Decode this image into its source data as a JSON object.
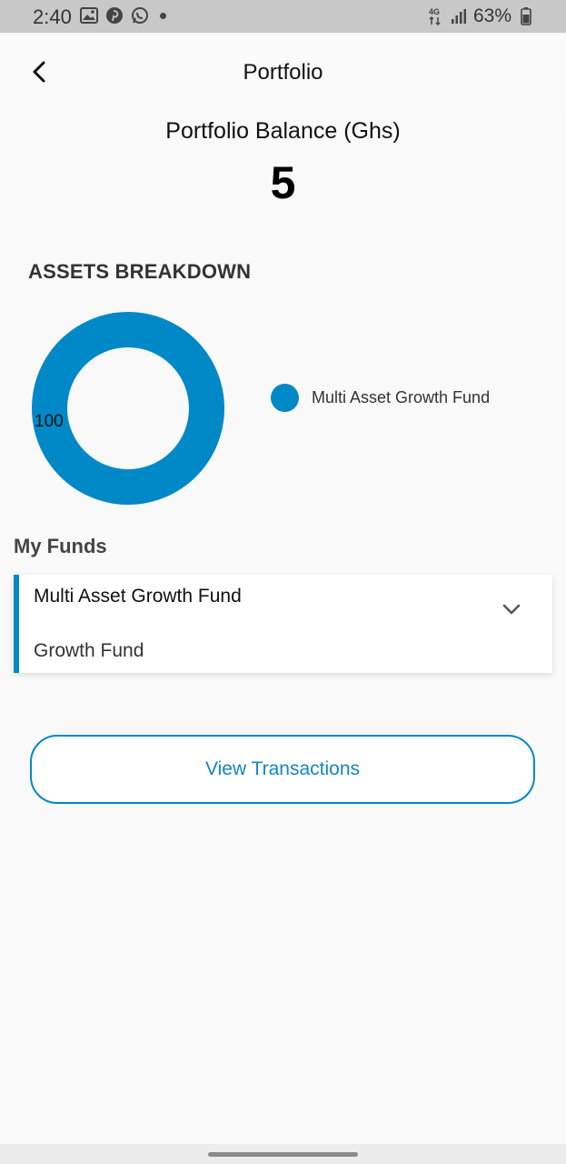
{
  "status_bar": {
    "time": "2:40",
    "battery_percent": "63%",
    "network_label": "4G",
    "icons": [
      "image-icon",
      "pinterest-icon",
      "whatsapp-icon",
      "notification-dot-icon",
      "network-4g-icon",
      "signal-icon",
      "battery-icon"
    ]
  },
  "header": {
    "title": "Portfolio",
    "back_icon": "chevron-left-icon"
  },
  "balance": {
    "label": "Portfolio Balance (Ghs)",
    "value": "5"
  },
  "assets": {
    "title": "ASSETS BREAKDOWN",
    "chart_data": {
      "type": "pie",
      "style": "donut",
      "series": [
        {
          "name": "Multi Asset Growth Fund",
          "value": 100,
          "color": "#0088c7"
        }
      ],
      "slice_label": "100",
      "legend_placement": "right"
    }
  },
  "my_funds": {
    "title": "My Funds",
    "items": [
      {
        "name": "Multi Asset Growth Fund",
        "type": "Growth Fund",
        "expand_icon": "chevron-down-icon"
      }
    ]
  },
  "actions": {
    "view_transactions_label": "View Transactions"
  },
  "colors": {
    "accent": "#0088c7",
    "status_bar": "#c8c8c8",
    "background": "#f9f9f9"
  }
}
